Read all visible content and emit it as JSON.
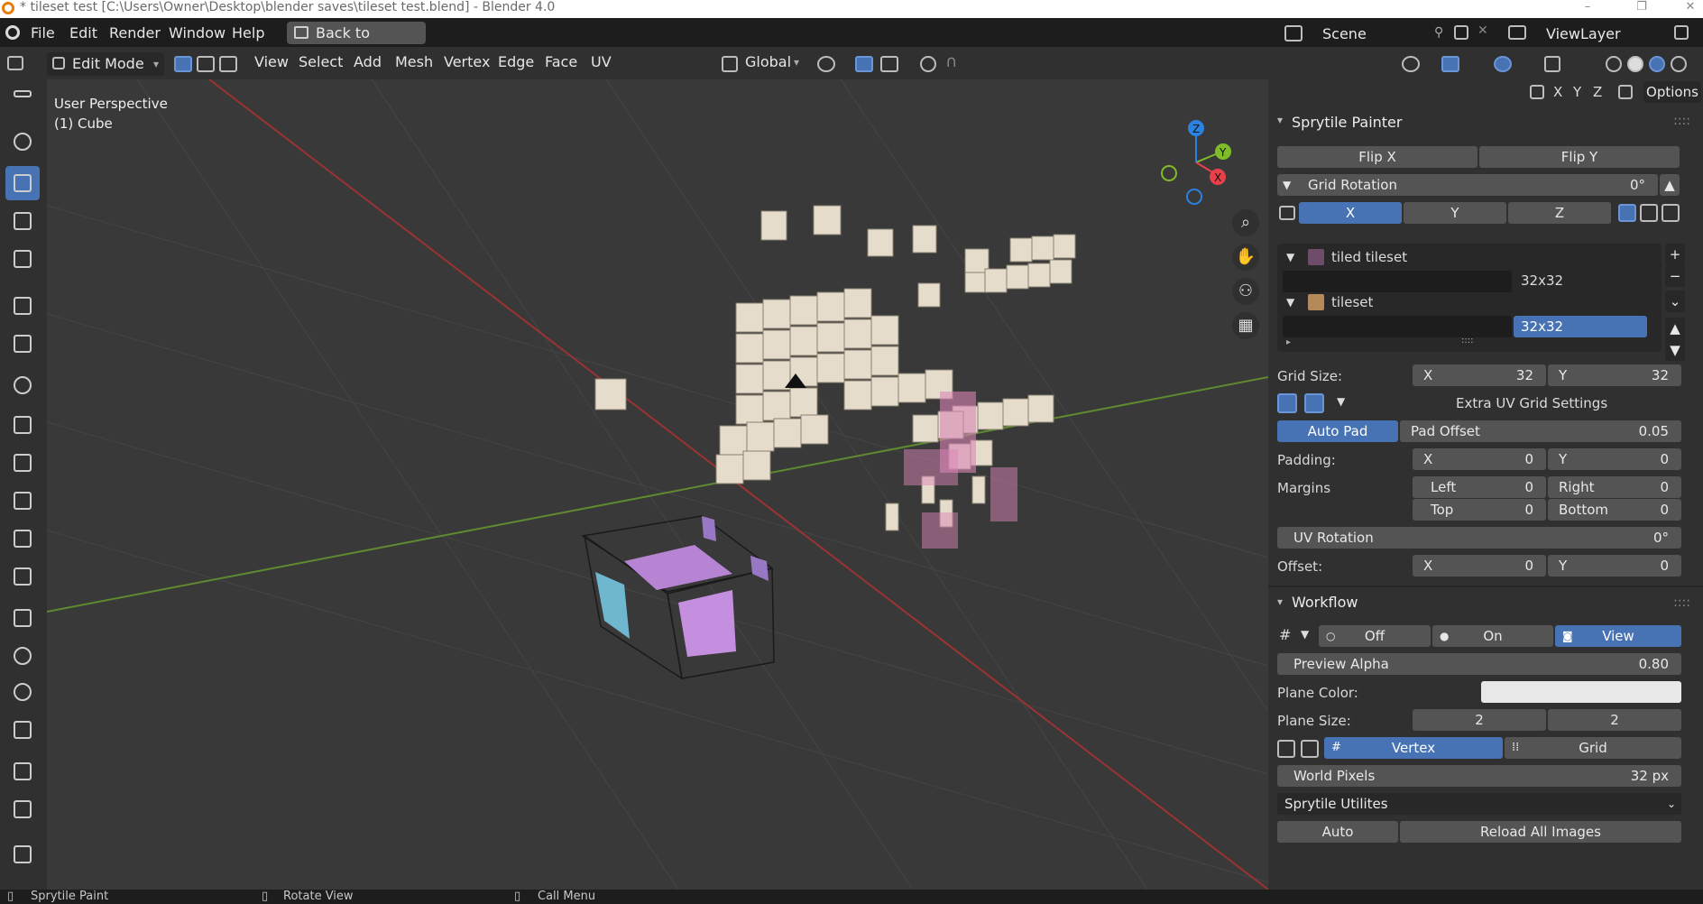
{
  "window": {
    "title": "* tileset test [C:\\Users\\Owner\\Desktop\\blender saves\\tileset test.blend] - Blender 4.0"
  },
  "menu": {
    "items": [
      "File",
      "Edit",
      "Render",
      "Window",
      "Help"
    ],
    "back_button": "Back to Previous"
  },
  "scene": {
    "name": "Scene",
    "view_layer": "ViewLayer"
  },
  "header": {
    "mode": "Edit Mode",
    "menus": [
      "View",
      "Select",
      "Add",
      "Mesh",
      "Vertex",
      "Edge",
      "Face",
      "UV"
    ],
    "transform_orientation": "Global"
  },
  "viewport": {
    "perspective_label": "User Perspective",
    "object_label": "(1) Cube"
  },
  "gizmo": {
    "x": "X",
    "y": "Y",
    "z": "Z"
  },
  "options": {
    "axes": [
      "X",
      "Y",
      "Z"
    ],
    "label": "Options"
  },
  "sprytile": {
    "title": "Sprytile Painter",
    "flip_x": "Flip X",
    "flip_y": "Flip Y",
    "grid_rotation_label": "Grid Rotation",
    "grid_rotation_value": "0°",
    "axes": [
      "X",
      "Y",
      "Z"
    ],
    "tilesets": [
      {
        "name": "tiled tileset",
        "size": "32x32"
      },
      {
        "name": "tileset",
        "size": "32x32"
      }
    ],
    "grid_size_label": "Grid Size:",
    "grid_size_x_label": "X",
    "grid_size_x": "32",
    "grid_size_y_label": "Y",
    "grid_size_y": "32",
    "extra_uv": "Extra UV Grid Settings",
    "auto_pad": "Auto Pad",
    "pad_offset_label": "Pad Offset",
    "pad_offset": "0.05",
    "padding_label": "Padding:",
    "padding_x_label": "X",
    "padding_x": "0",
    "padding_y_label": "Y",
    "padding_y": "0",
    "margins_label": "Margins",
    "left_label": "Left",
    "left": "0",
    "right_label": "Right",
    "right": "0",
    "top_label": "Top",
    "top": "0",
    "bottom_label": "Bottom",
    "bottom": "0",
    "uv_rotation_label": "UV Rotation",
    "uv_rotation": "0°",
    "offset_label": "Offset:",
    "offset_x_label": "X",
    "offset_x": "0",
    "offset_y_label": "Y",
    "offset_y": "0"
  },
  "workflow": {
    "title": "Workflow",
    "off": "Off",
    "on": "On",
    "view": "View",
    "preview_alpha_label": "Preview Alpha",
    "preview_alpha": "0.80",
    "plane_color_label": "Plane Color:",
    "plane_size_label": "Plane Size:",
    "plane_size_x": "2",
    "plane_size_y": "2",
    "vertex": "Vertex",
    "grid": "Grid",
    "world_pixels_label": "World Pixels",
    "world_pixels": "32 px",
    "utilities_select": "Sprytile Utilites",
    "auto": "Auto",
    "reload": "Reload All Images"
  },
  "status": {
    "items": [
      "Sprytile Paint",
      "Rotate View",
      "Call Menu"
    ]
  },
  "colors": {
    "accent": "#4772b3",
    "x_axis": "#e8404a",
    "y_axis": "#7fbd28",
    "z_axis": "#2a83e0",
    "brand": "#e87d0d"
  }
}
